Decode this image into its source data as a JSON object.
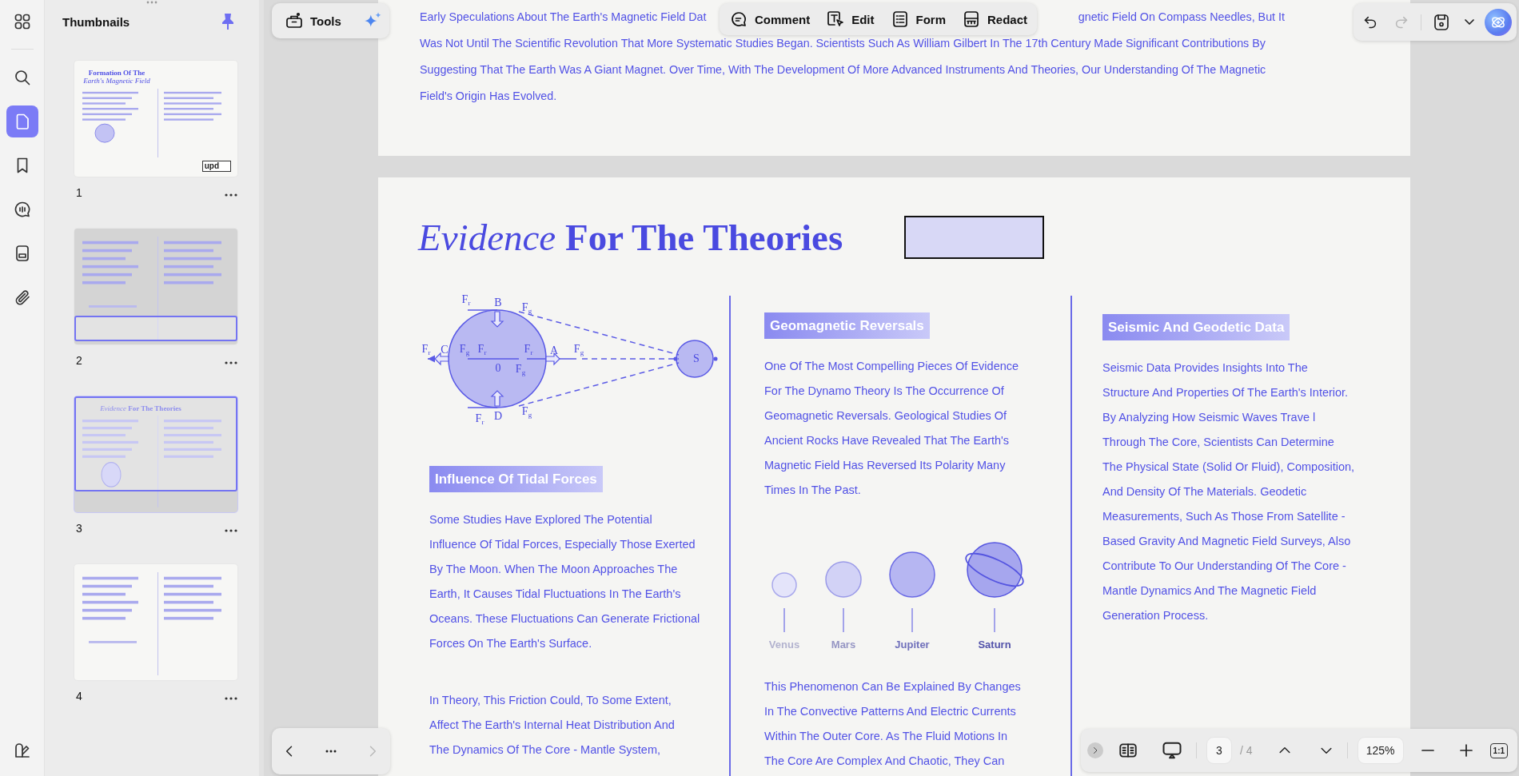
{
  "rail": {
    "items": [
      {
        "kind": "apps",
        "selected": false
      },
      {
        "kind": "search",
        "selected": false
      },
      {
        "kind": "pages",
        "selected": true
      },
      {
        "kind": "bookmark",
        "selected": false
      },
      {
        "kind": "comment",
        "selected": false
      },
      {
        "kind": "form",
        "selected": false
      },
      {
        "kind": "attachment",
        "selected": false
      },
      {
        "kind": "appearance",
        "selected": false
      }
    ]
  },
  "thumbnails": {
    "title": "Thumbnails",
    "pinned": true,
    "pages": [
      {
        "number": "1",
        "title": "**Formation Of The** *Earth's Magnetic Field*",
        "stamp": "upd",
        "in_view": false,
        "selected": false
      },
      {
        "number": "2",
        "in_view": true,
        "selected": false
      },
      {
        "number": "3",
        "title": "*Evidence* **For The Theories**",
        "in_view": true,
        "selected": true
      },
      {
        "number": "4",
        "in_view": false,
        "selected": false
      }
    ]
  },
  "tools_group": {
    "label": "Tools"
  },
  "edit_toolbar": [
    {
      "kind": "comment",
      "label": "Comment"
    },
    {
      "kind": "edit",
      "label": "Edit"
    },
    {
      "kind": "form",
      "label": "Form"
    },
    {
      "kind": "redact",
      "label": "Redact"
    }
  ],
  "history": {
    "undo_disabled": false,
    "redo_disabled": true
  },
  "page_2_tail": {
    "lines": [
      [
        "Early Speculations About The Earth's Magnetic Field Dat",
        "gnetic Field On Compass Needles, But It"
      ],
      [
        "Was Not Until The Scientific Revolution That More Systematic Studies Began. Scientists Such As William Gilbert In The 17th Century Made Significant Contributions By"
      ],
      [
        "Suggesting That The Earth Was A Giant Magnet. Over Time, With The Development Of More Advanced Instruments And Theories, Our Understanding Of The Magnetic"
      ],
      [
        "Field's Origin Has Evolved."
      ]
    ]
  },
  "page_3": {
    "title": "*Evidence* **For The Theories**",
    "columns": [
      {
        "blocks": [
          {
            "kind": "diagram",
            "labels": [
              "F$_{r}$",
              "B",
              "F$_{g}$",
              "F$_{r}$",
              "C",
              "F$_{g}$",
              "F$_{r}$",
              "0",
              "F$_{r}$",
              "F$_{g}$",
              "A",
              "F$_{g}$",
              "S",
              "F$_{r}$",
              "D",
              "F$_{g}$"
            ]
          },
          {
            "kind": "heading",
            "text": "Influence Of Tidal Forces"
          },
          {
            "kind": "paragraph",
            "lines": [
              "Some Studies Have Explored The Potential",
              "Influence Of Tidal Forces, Especially Those Exerted",
              "By The Moon. When The Moon Approaches The",
              "Earth, It Causes Tidal Fluctuations In The Earth's",
              "Oceans. These Fluctuations Can Generate Frictional",
              "Forces On The Earth's Surface."
            ]
          },
          {
            "kind": "paragraph",
            "lines": [
              " In Theory, This Friction Could, To Some Extent,",
              "Affect The Earth's Internal Heat Distribution And",
              "The Dynamics Of The Core - Mantle System,"
            ]
          }
        ]
      },
      {
        "blocks": [
          {
            "kind": "heading",
            "text": "Geomagnetic Reversals"
          },
          {
            "kind": "paragraph",
            "lines": [
              "One Of The Most Compelling Pieces Of Evidence",
              "For The Dynamo Theory Is The Occurrence Of",
              "Geomagnetic Reversals. Geological Studies Of",
              "Ancient Rocks Have Revealed That The Earth's",
              "Magnetic Field Has Reversed Its Polarity Many",
              "Times In The Past."
            ]
          },
          {
            "kind": "planets",
            "items": [
              {
                "kind": "small",
                "name": "Venus",
                "color": "#b3b3cf"
              },
              {
                "kind": "medium",
                "name": "Mars",
                "color": "#9696c4"
              },
              {
                "kind": "large",
                "name": "Jupiter",
                "color": "#7070bb"
              },
              {
                "kind": "ringed",
                "name": "Saturn",
                "color": "#5353aa"
              }
            ]
          },
          {
            "kind": "paragraph",
            "lines": [
              "This Phenomenon Can Be Explained By Changes",
              "In The Convective Patterns And Electric Currents",
              "Within The Outer Core. As The Fluid Motions In",
              "The Core Are Complex And Chaotic, They Can"
            ]
          }
        ]
      },
      {
        "blocks": [
          {
            "kind": "heading",
            "text": "Seismic And Geodetic Data"
          },
          {
            "kind": "paragraph",
            "lines": [
              "Seismic Data Provides Insights Into The",
              "Structure And Properties Of The Earth's Interior.",
              "By Analyzing How Seismic Waves Trave l",
              "Through The Core, Scientists Can Determine",
              "The Physical State (Solid Or Fluid), Composition,",
              "And Density Of The Materials. Geodetic",
              "Measurements, Such As Those From Satellite -",
              "Based Gravity And Magnetic Field Surveys, Also",
              "Contribute To Our Understanding Of The Core -",
              "Mantle Dynamics And The Magnetic Field",
              "Generation Process."
            ]
          }
        ]
      }
    ]
  },
  "page_nav": {
    "prev_disabled": false,
    "next_disabled": true
  },
  "view_bar": {
    "page": "3",
    "total": "/ 4",
    "zoom": "125%",
    "actual_size": "1:1"
  }
}
